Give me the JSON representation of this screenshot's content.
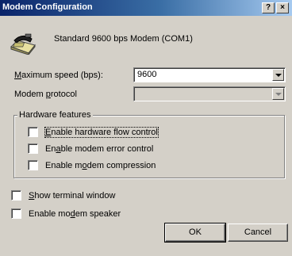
{
  "window": {
    "title": "Modem Configuration",
    "help_button": "?",
    "close_button": "×"
  },
  "device": {
    "name": "Standard  9600 bps Modem (COM1)",
    "icon": "modem-phone-icon"
  },
  "max_speed": {
    "label_prefix": "",
    "label_accel": "M",
    "label_rest": "aximum speed (bps):",
    "value": "9600"
  },
  "modem_protocol": {
    "label_prefix": "Modem ",
    "label_accel": "p",
    "label_rest": "rotocol",
    "value": ""
  },
  "hardware_features": {
    "title": "Hardware features",
    "options": [
      {
        "prefix": "",
        "accel": "E",
        "rest": "nable hardware flow control",
        "checked": false
      },
      {
        "prefix": "En",
        "accel": "a",
        "rest": "ble modem error control",
        "checked": false
      },
      {
        "prefix": "Enable m",
        "accel": "o",
        "rest": "dem compression",
        "checked": false
      }
    ]
  },
  "options": [
    {
      "prefix": "",
      "accel": "S",
      "rest": "how terminal window",
      "checked": false
    },
    {
      "prefix": "Enable mo",
      "accel": "d",
      "rest": "em speaker",
      "checked": false
    }
  ],
  "buttons": {
    "ok": "OK",
    "cancel": "Cancel"
  }
}
